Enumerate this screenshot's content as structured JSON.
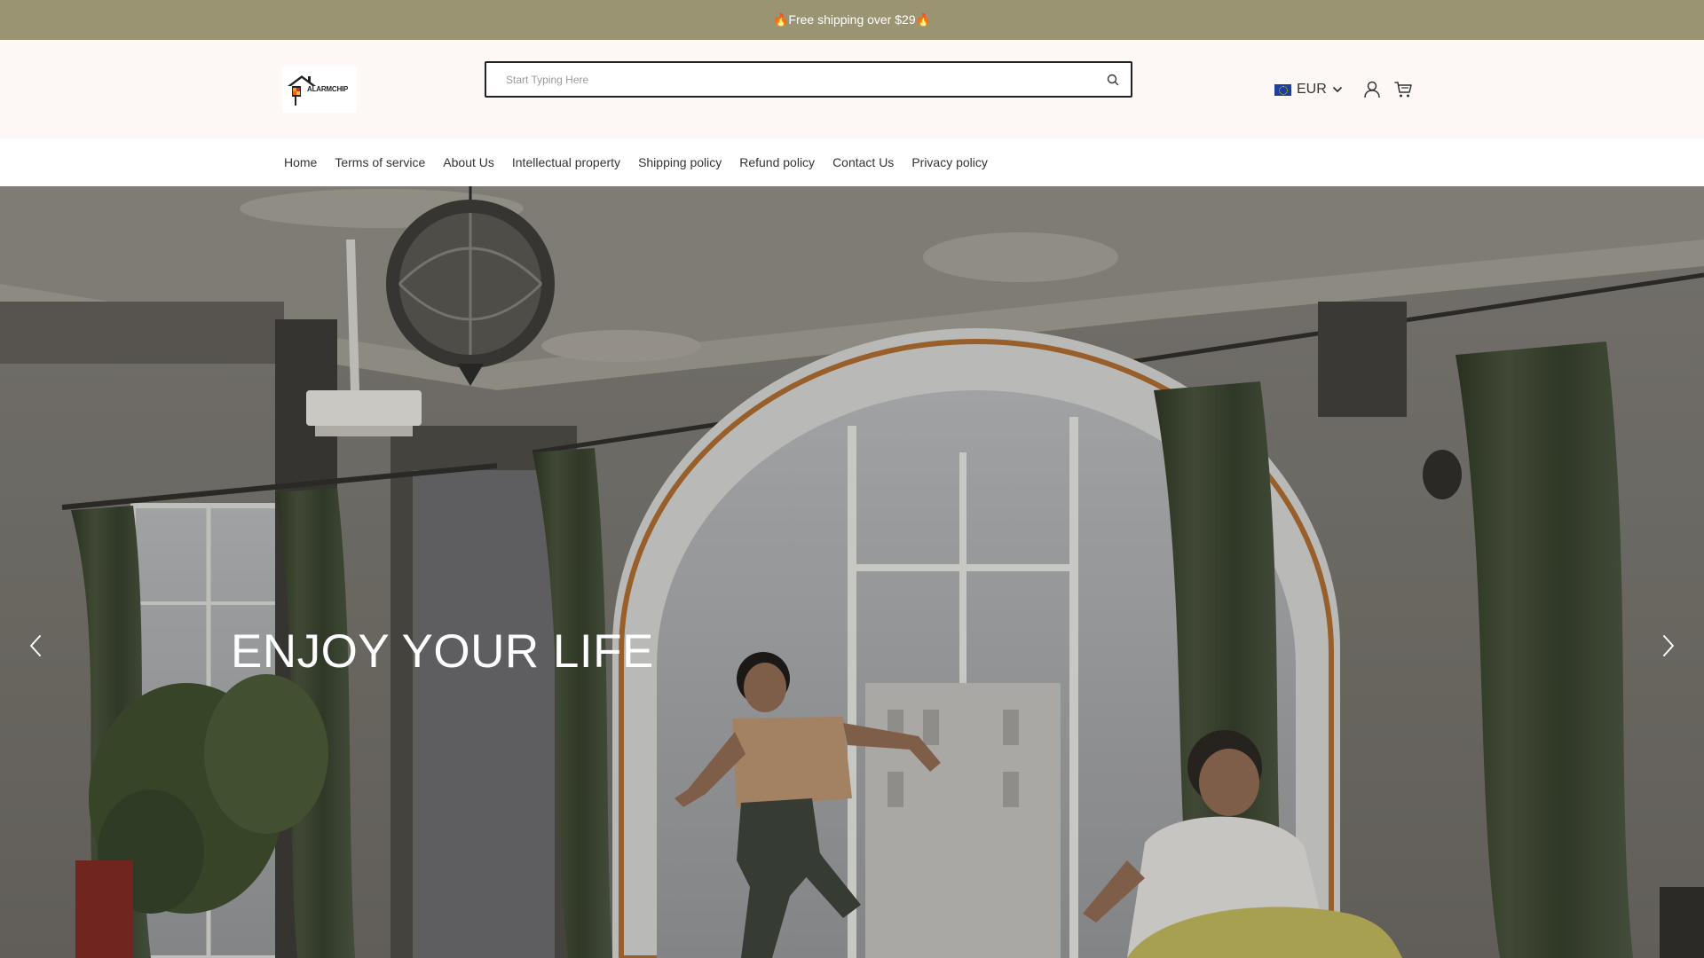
{
  "announcement": {
    "text": "🔥Free shipping over $29🔥"
  },
  "header": {
    "logo_text": "ALARMCHIP",
    "search": {
      "placeholder": "Start Typing Here",
      "value": ""
    },
    "currency": {
      "code": "EUR",
      "flag_icon": "eu-flag-icon"
    },
    "icons": [
      "search-icon",
      "chevron-down-icon",
      "user-icon",
      "cart-icon"
    ]
  },
  "nav": {
    "items": [
      {
        "label": "Home"
      },
      {
        "label": "Terms of service"
      },
      {
        "label": "About Us"
      },
      {
        "label": "Intellectual property"
      },
      {
        "label": "Shipping policy"
      },
      {
        "label": "Refund policy"
      },
      {
        "label": "Contact Us"
      },
      {
        "label": "Privacy policy"
      }
    ]
  },
  "hero": {
    "heading": "ENJOY YOUR LIFE",
    "prev_icon": "chevron-left-icon",
    "next_icon": "chevron-right-icon"
  },
  "colors": {
    "announcement_bg": "#9a9472",
    "header_bg": "#fdf8f6",
    "text": "#333333"
  }
}
